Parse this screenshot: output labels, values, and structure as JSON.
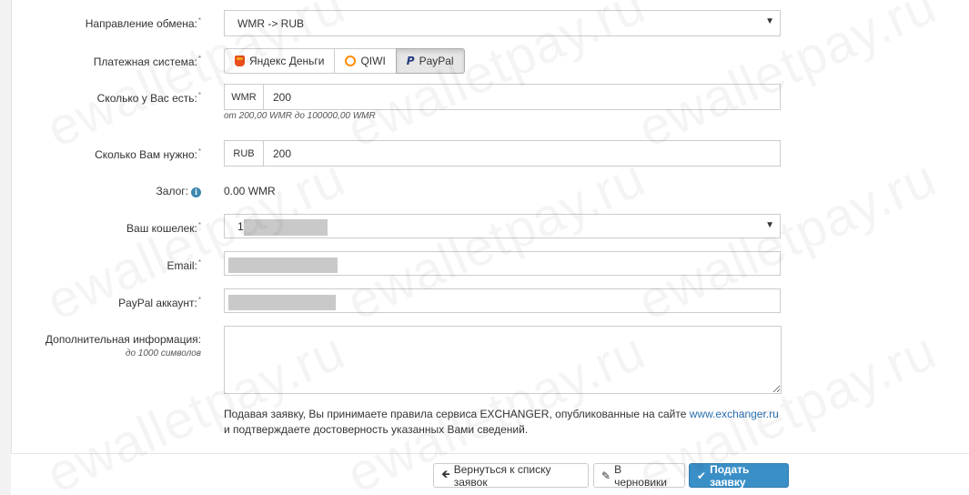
{
  "form": {
    "direction": {
      "label": "Направление обмена:",
      "value": "WMR -> RUB"
    },
    "payment_system": {
      "label": "Платежная система:",
      "options": [
        "Яндекс Деньги",
        "QIWI",
        "PayPal"
      ],
      "selected": "PayPal"
    },
    "have": {
      "label": "Сколько у Вас есть:",
      "currency": "WMR",
      "value": "200",
      "hint": "от 200,00 WMR до 100000,00 WMR"
    },
    "need": {
      "label": "Сколько Вам нужно:",
      "currency": "RUB",
      "value": "200"
    },
    "deposit": {
      "label": "Залог:",
      "value": "0.00 WMR"
    },
    "wallet": {
      "label": "Ваш кошелек:",
      "value": "1"
    },
    "email": {
      "label": "Email:"
    },
    "paypal_account": {
      "label": "PayPal аккаунт:"
    },
    "extra": {
      "label": "Дополнительная информация:",
      "hint": "до 1000 символов"
    }
  },
  "terms": {
    "line1": "Подавая заявку, Вы принимаете правила сервиса EXCHANGER, опубликованные на сайте",
    "link": "www.exchanger.ru",
    "line2": "и подтверждаете достоверность указанных Вами сведений."
  },
  "footer": {
    "back_label": "Вернуться к списку заявок",
    "draft_label": "В черновики",
    "submit_label": "Подать заявку"
  },
  "watermark": "ewalletpay.ru",
  "icons": {
    "back": "arrow-left-icon",
    "draft": "edit-icon",
    "submit": "check-icon",
    "info": "info-circle-icon",
    "yandex": "yandex-money-icon",
    "qiwi": "qiwi-icon",
    "paypal": "paypal-icon"
  },
  "colors": {
    "primary": "#3a8fc7",
    "link": "#2a6fb0",
    "info": "#3a87ad"
  }
}
